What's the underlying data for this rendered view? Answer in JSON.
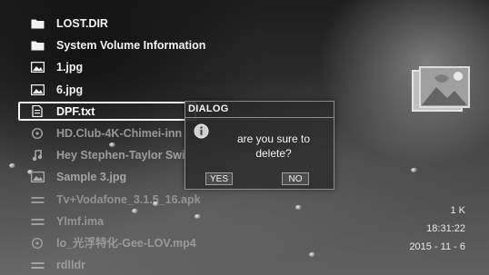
{
  "files": [
    {
      "name": "LOST.DIR",
      "icon": "folder-icon",
      "state": "normal"
    },
    {
      "name": "System Volume Information",
      "icon": "folder-icon",
      "state": "normal"
    },
    {
      "name": "1.jpg",
      "icon": "image-file-icon",
      "state": "normal"
    },
    {
      "name": "6.jpg",
      "icon": "image-file-icon",
      "state": "normal"
    },
    {
      "name": "DPF.txt",
      "icon": "text-file-icon",
      "state": "selected"
    },
    {
      "name": "HD.Club-4K-Chimei-inn",
      "icon": "video-file-icon",
      "state": "dim"
    },
    {
      "name": "Hey Stephen-Taylor Swi",
      "icon": "music-file-icon",
      "state": "dim"
    },
    {
      "name": "Sample 3.jpg",
      "icon": "image-file-icon",
      "state": "dim"
    },
    {
      "name": "Tv+Vodafone_3.1.5_16.apk",
      "icon": "apk-file-icon",
      "state": "faint"
    },
    {
      "name": "Ylmf.ima",
      "icon": "generic-file-icon",
      "state": "faint"
    },
    {
      "name": "lo_光浮特化-Gee-LOV.mp4",
      "icon": "video-file-icon",
      "state": "faint"
    },
    {
      "name": "rdlldr",
      "icon": "generic-file-icon",
      "state": "faint"
    }
  ],
  "info": {
    "size": "1 K",
    "time": "18:31:22",
    "date": "2015 - 11 - 6"
  },
  "dialog": {
    "title": "DIALOG",
    "message_line1": "are you sure to",
    "message_line2": "delete?",
    "yes_label": "YES",
    "no_label": "NO",
    "icon": "info-icon"
  },
  "thumbnail": {
    "icon": "picture-thumbnail-icon"
  }
}
